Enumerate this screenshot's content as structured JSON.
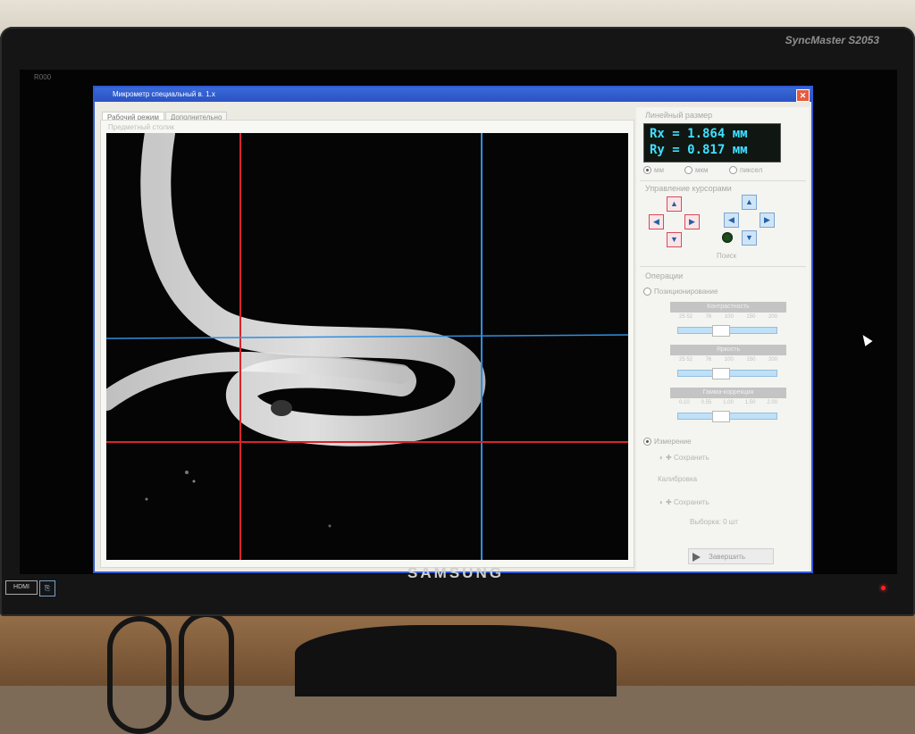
{
  "window": {
    "title": "Микрометр специальный в. 1.x",
    "close_icon": "close-icon"
  },
  "tabs": [
    {
      "label": "Рабочий режим",
      "active": true
    },
    {
      "label": "Дополнительно",
      "active": false
    }
  ],
  "left_panel": {
    "group_label": "Предметный столик"
  },
  "measure": {
    "title": "Линейный размер",
    "rx": "Rx = 1.864 мм",
    "ry": "Ry = 0.817 мм",
    "units": [
      {
        "label": "мм",
        "selected": true
      },
      {
        "label": "мкм",
        "selected": false
      },
      {
        "label": "пиксел",
        "selected": false
      }
    ]
  },
  "cursors": {
    "title": "Управление курсорами",
    "search_label": "Поиск",
    "arrow_icons": [
      "arrow-up-icon",
      "arrow-left-icon",
      "arrow-right-icon",
      "arrow-down-icon"
    ]
  },
  "options": {
    "title": "Операции",
    "positioning_label": "Позиционирование",
    "contrast": {
      "label": "Контрастность",
      "ticks": [
        "25 52",
        "76",
        "100",
        "150",
        "200"
      ]
    },
    "brightness": {
      "label": "Яркость",
      "ticks": [
        "25 52",
        "76",
        "100",
        "150",
        "200"
      ]
    },
    "gamma": {
      "label": "Гамма-коррекция",
      "ticks": [
        "0.10",
        "0.55",
        "1.00",
        "1.50",
        "2.00"
      ]
    },
    "measurement_label": "Измерение",
    "save_label": "Сохранить",
    "calibration_label": "Калибровка",
    "save_label_2": "Сохранить",
    "sample_label": "Выборка: 0 шт",
    "finish_label": "Завершить"
  },
  "monitor": {
    "brand": "SAMSUNG",
    "model": "SyncMaster S2053",
    "hdmi": "HDMI",
    "osd_label": "R000"
  },
  "colors": {
    "titlebar": "#2a52c3",
    "readout_text": "#3fe0ff",
    "cursor_red": "#d8242c",
    "cursor_blue": "#2f8fe0"
  }
}
